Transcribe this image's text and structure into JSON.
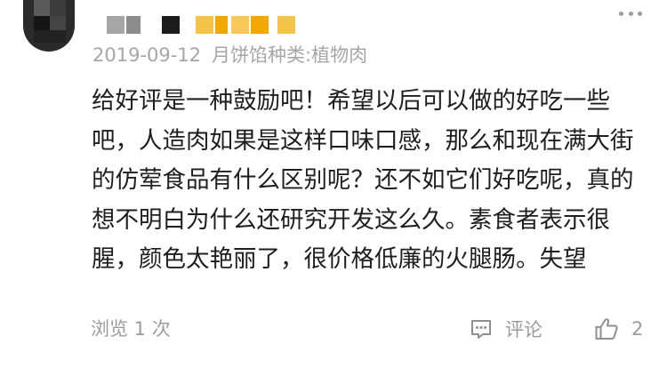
{
  "review": {
    "author_name_masked": "",
    "meta": {
      "date": "2019-09-12",
      "flavor_label": "月饼馅种类:植物肉"
    },
    "content": "给好评是一种鼓励吧！希望以后可以做的好吃一些吧，人造肉如果是这样口味口感，那么和现在满大街的仿荤食品有什么区别呢？还不如它们好吃呢，真的想不明白为什么还研究开发这么久。素食者表示很腥，颜色太艳丽了，很价格低廉的火腿肠。失望",
    "footer": {
      "views": "浏览 1 次",
      "comment_label": "评论",
      "like_count": "2"
    }
  },
  "icons": {
    "more": "more-dots-icon",
    "comment": "comment-bubble-icon",
    "like": "thumbs-up-icon"
  },
  "colors": {
    "meta_text": "#a6a6a6",
    "body_text": "#1e1e1e",
    "footer_text": "#9b9b9b",
    "username_mosaic": [
      "#a0a0a0",
      "#606060",
      "#202020",
      "#f5c54b",
      "#f2a800"
    ]
  }
}
